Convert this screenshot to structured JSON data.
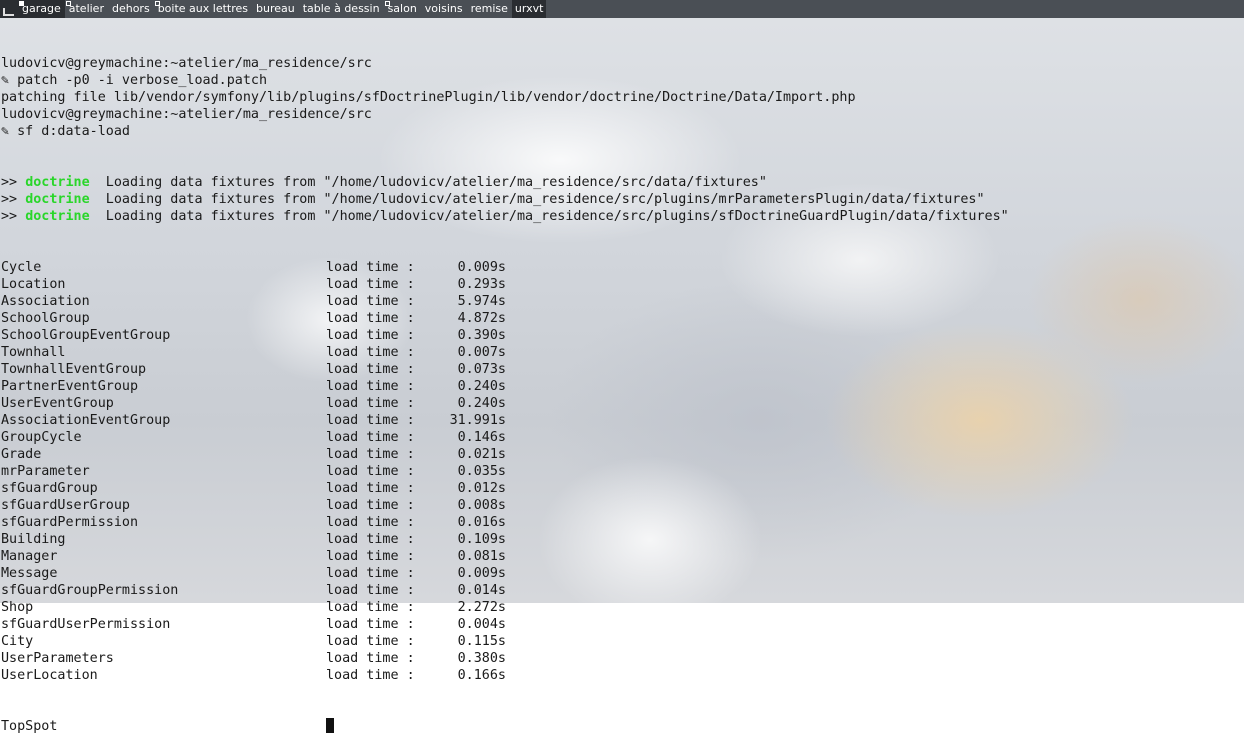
{
  "tagbar": {
    "tags": [
      {
        "label": "garage",
        "selected": true,
        "occupied": true
      },
      {
        "label": "atelier",
        "selected": false,
        "occupied": true
      },
      {
        "label": "dehors",
        "selected": false,
        "occupied": false
      },
      {
        "label": "boite aux lettres",
        "selected": false,
        "occupied": true
      },
      {
        "label": "bureau",
        "selected": false,
        "occupied": false
      },
      {
        "label": "table à dessin",
        "selected": false,
        "occupied": false
      },
      {
        "label": "salon",
        "selected": false,
        "occupied": true
      },
      {
        "label": "voisins",
        "selected": false,
        "occupied": false
      },
      {
        "label": "remise",
        "selected": false,
        "occupied": false
      }
    ],
    "window_title": "urxvt"
  },
  "terminal": {
    "header_lines": [
      "ludovicv@greymachine:~atelier/ma_residence/src",
      "✎ patch -p0 -i verbose_load.patch",
      "patching file lib/vendor/symfony/lib/plugins/sfDoctrinePlugin/lib/vendor/doctrine/Doctrine/Data/Import.php",
      "ludovicv@greymachine:~atelier/ma_residence/src",
      "✎ sf d:data-load"
    ],
    "doctrine_lines": [
      {
        "prefix": ">> ",
        "keyword": "doctrine",
        "text": "  Loading data fixtures from \"/home/ludovicv/atelier/ma_residence/src/data/fixtures\""
      },
      {
        "prefix": ">> ",
        "keyword": "doctrine",
        "text": "  Loading data fixtures from \"/home/ludovicv/atelier/ma_residence/src/plugins/mrParametersPlugin/data/fixtures\""
      },
      {
        "prefix": ">> ",
        "keyword": "doctrine",
        "text": "  Loading data fixtures from \"/home/ludovicv/atelier/ma_residence/src/plugins/sfDoctrineGuardPlugin/data/fixtures\""
      }
    ],
    "load_label": "load time :",
    "load_rows": [
      {
        "name": "Cycle",
        "time": "0.009s"
      },
      {
        "name": "Location",
        "time": "0.293s"
      },
      {
        "name": "Association",
        "time": "5.974s"
      },
      {
        "name": "SchoolGroup",
        "time": "4.872s"
      },
      {
        "name": "SchoolGroupEventGroup",
        "time": "0.390s"
      },
      {
        "name": "Townhall",
        "time": "0.007s"
      },
      {
        "name": "TownhallEventGroup",
        "time": "0.073s"
      },
      {
        "name": "PartnerEventGroup",
        "time": "0.240s"
      },
      {
        "name": "UserEventGroup",
        "time": "0.240s"
      },
      {
        "name": "AssociationEventGroup",
        "time": "31.991s"
      },
      {
        "name": "GroupCycle",
        "time": "0.146s"
      },
      {
        "name": "Grade",
        "time": "0.021s"
      },
      {
        "name": "mrParameter",
        "time": "0.035s"
      },
      {
        "name": "sfGuardGroup",
        "time": "0.012s"
      },
      {
        "name": "sfGuardUserGroup",
        "time": "0.008s"
      },
      {
        "name": "sfGuardPermission",
        "time": "0.016s"
      },
      {
        "name": "Building",
        "time": "0.109s"
      },
      {
        "name": "Manager",
        "time": "0.081s"
      },
      {
        "name": "Message",
        "time": "0.009s"
      },
      {
        "name": "sfGuardGroupPermission",
        "time": "0.014s"
      },
      {
        "name": "Shop",
        "time": "2.272s"
      },
      {
        "name": "sfGuardUserPermission",
        "time": "0.004s"
      },
      {
        "name": "City",
        "time": "0.115s"
      },
      {
        "name": "UserParameters",
        "time": "0.380s"
      },
      {
        "name": "UserLocation",
        "time": "0.166s"
      }
    ],
    "last_line": "TopSpot"
  }
}
